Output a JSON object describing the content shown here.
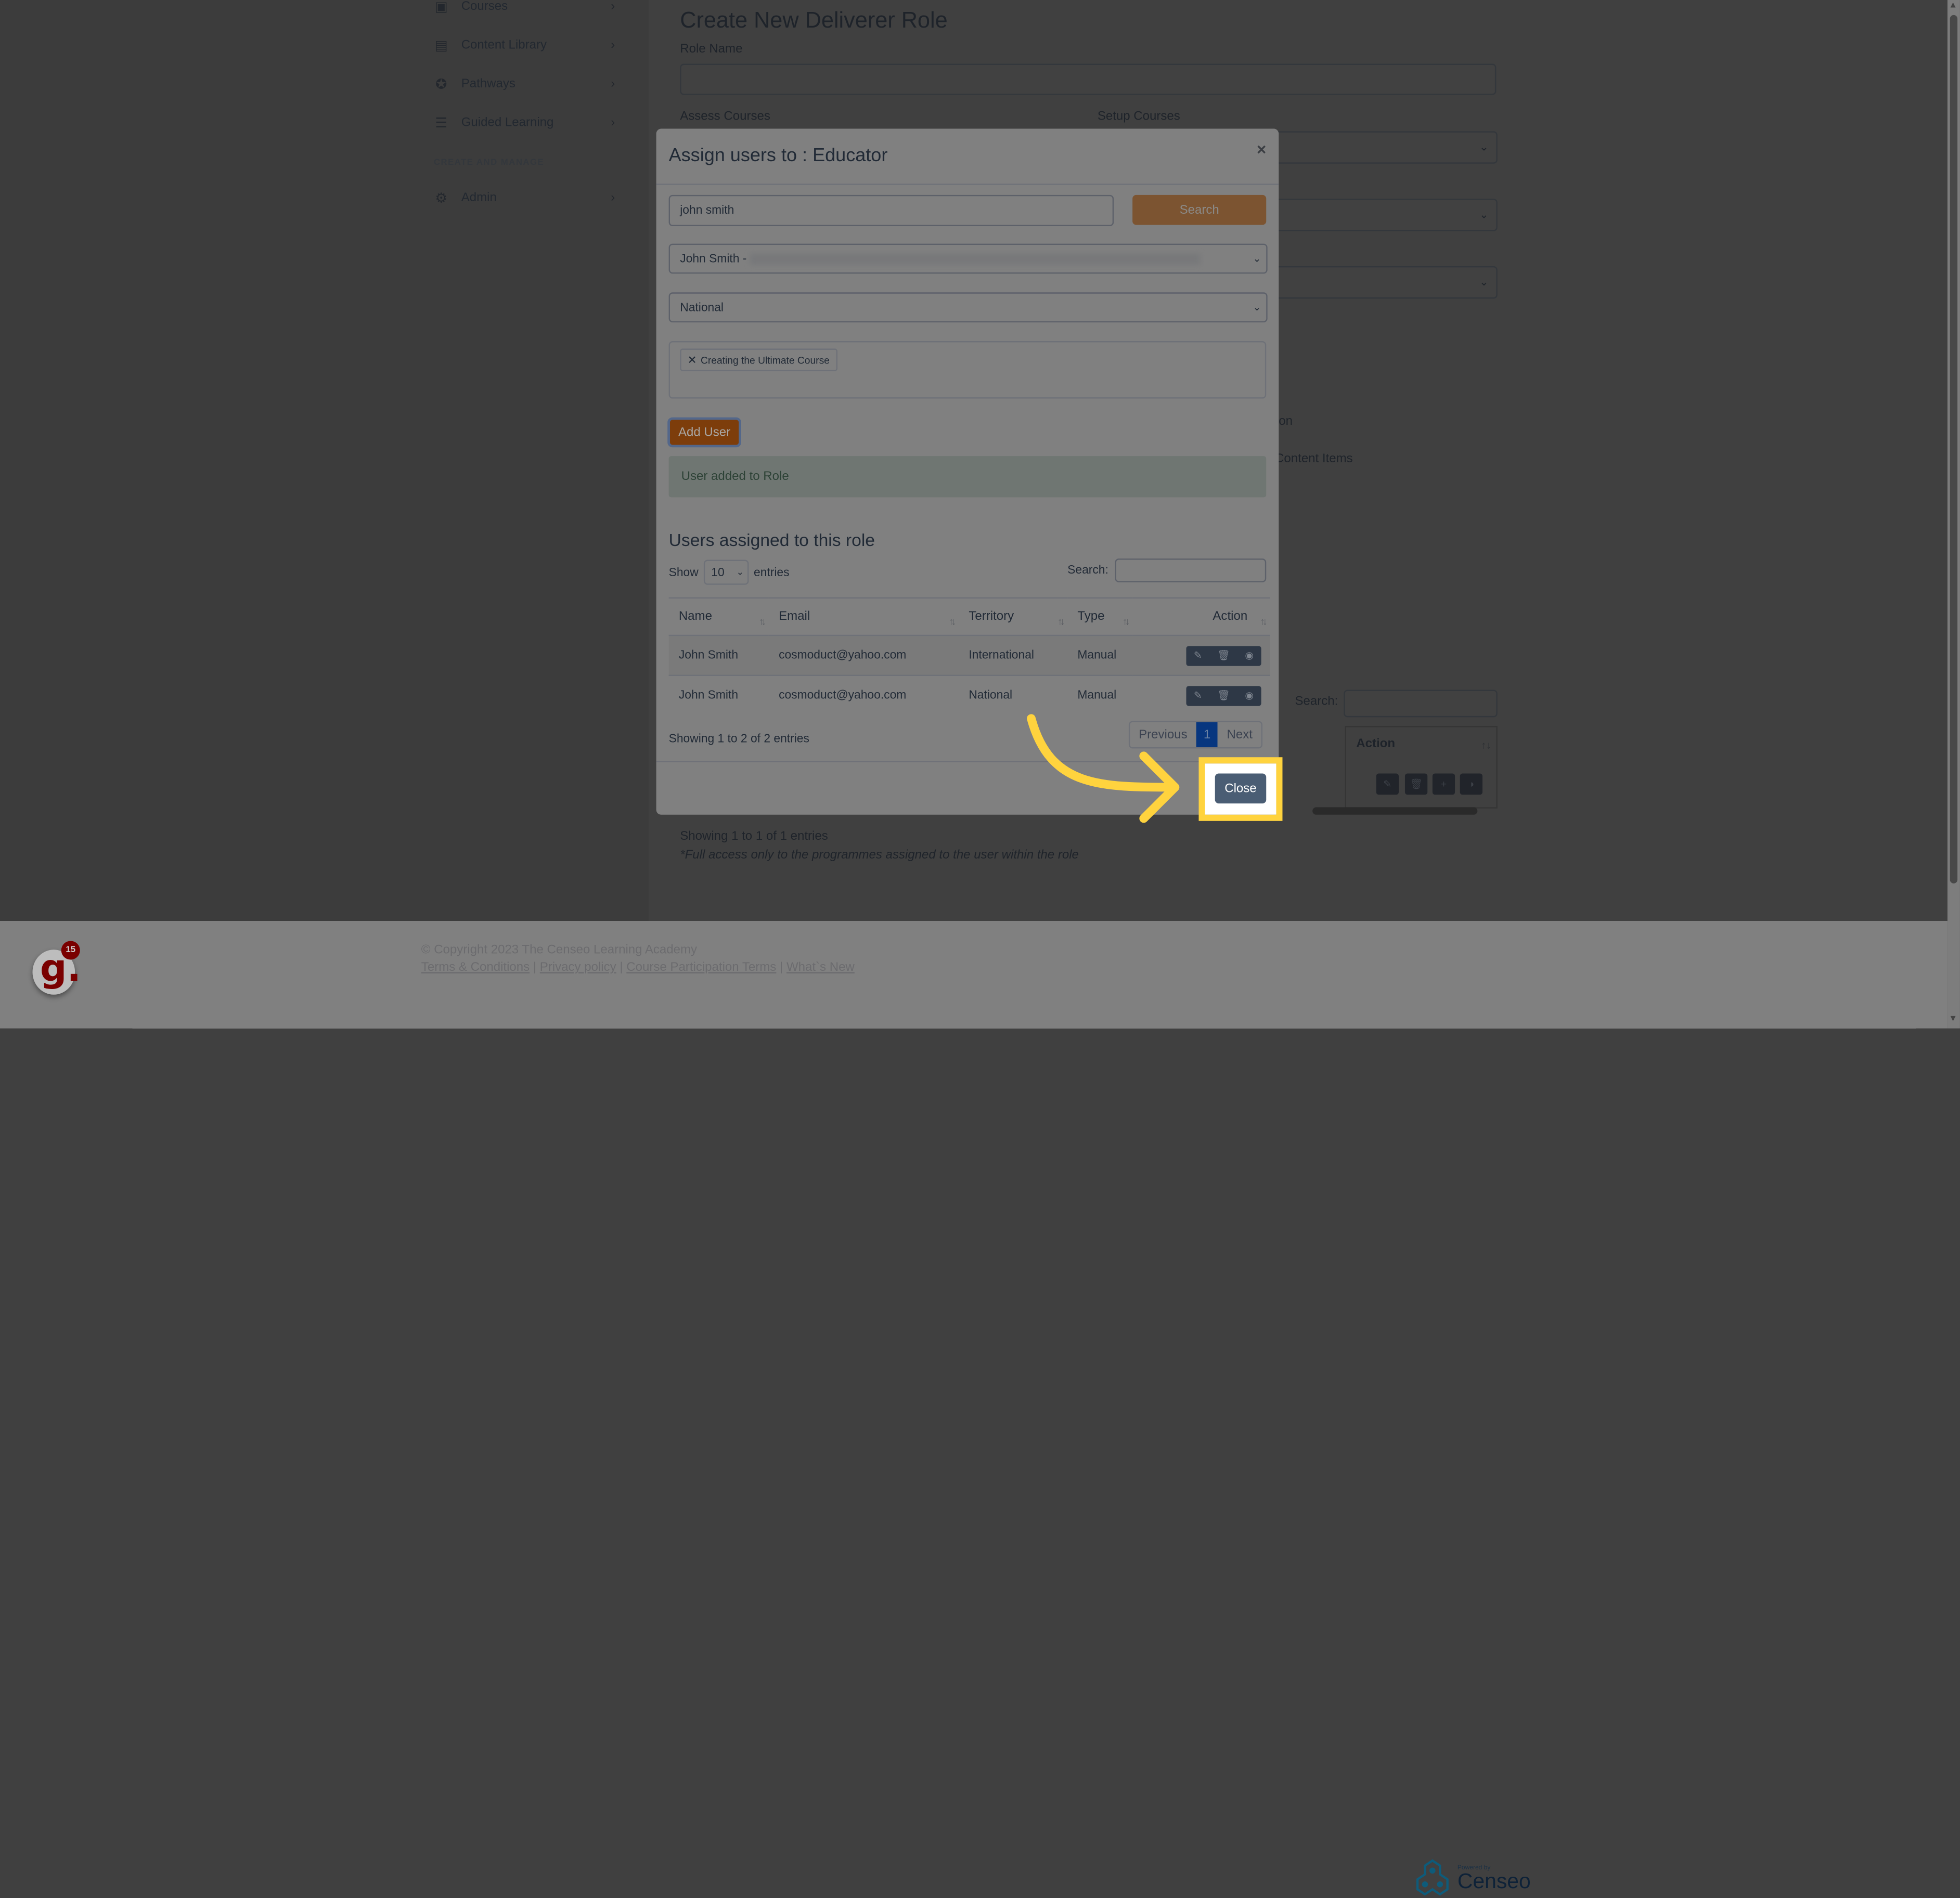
{
  "sidebar": {
    "items": [
      {
        "label": "Courses",
        "icon": "courses-icon"
      },
      {
        "label": "Content Library",
        "icon": "book-icon"
      },
      {
        "label": "Pathways",
        "icon": "award-icon"
      },
      {
        "label": "Guided Learning",
        "icon": "clipboard-list-icon"
      }
    ],
    "section_label": "CREATE AND MANAGE",
    "admin": {
      "label": "Admin",
      "icon": "gear-icon"
    }
  },
  "background_page": {
    "title": "Create New Deliverer Role",
    "role_name_label": "Role Name",
    "assess_courses_label": "Assess Courses",
    "setup_courses_label": "Setup Courses",
    "partial_text_1": "on",
    "partial_text_2": "Content Items",
    "search_label": "Search:",
    "table_action_header": "Action",
    "showing_text": "Showing 1 to 1 of 1 entries",
    "note": "*Full access only to the programmes assigned to the user within the role"
  },
  "modal": {
    "title": "Assign users to : Educator",
    "close_glyph": "×",
    "search_value": "john smith",
    "search_button": "Search",
    "user_select_value": "John Smith -",
    "territory_select_value": "National",
    "selected_course_tag": "Creating the Ultimate Course",
    "add_user_button": "Add User",
    "alert_text": "User added to Role",
    "users_heading": "Users assigned to this role",
    "show_label": "Show",
    "entries_label": "entries",
    "page_length": "10",
    "table_search_label": "Search:",
    "columns": [
      "Name",
      "Email",
      "Territory",
      "Type",
      "Action"
    ],
    "rows": [
      {
        "name": "John Smith",
        "email": "cosmoduct@yahoo.com",
        "territory": "International",
        "type": "Manual"
      },
      {
        "name": "John Smith",
        "email": "cosmoduct@yahoo.com",
        "territory": "National",
        "type": "Manual"
      }
    ],
    "info": "Showing 1 to 2 of 2 entries",
    "pager": {
      "previous": "Previous",
      "current": "1",
      "next": "Next"
    },
    "close_button": "Close"
  },
  "footer": {
    "copyright": "© Copyright 2023 The Censeo Learning Academy",
    "links": [
      "Terms & Conditions",
      "Privacy policy",
      "Course Participation Terms",
      "What`s New"
    ],
    "separator": " | ",
    "powered_by": "Powered by",
    "brand": "Censeo",
    "badge_letter": "g.",
    "badge_count": "15"
  },
  "colors": {
    "highlight": "#ffd33e",
    "search_button": "#c98a50",
    "add_user_button": "#cc6414",
    "close_button": "#4a5d74",
    "pager_active": "#07367f"
  }
}
